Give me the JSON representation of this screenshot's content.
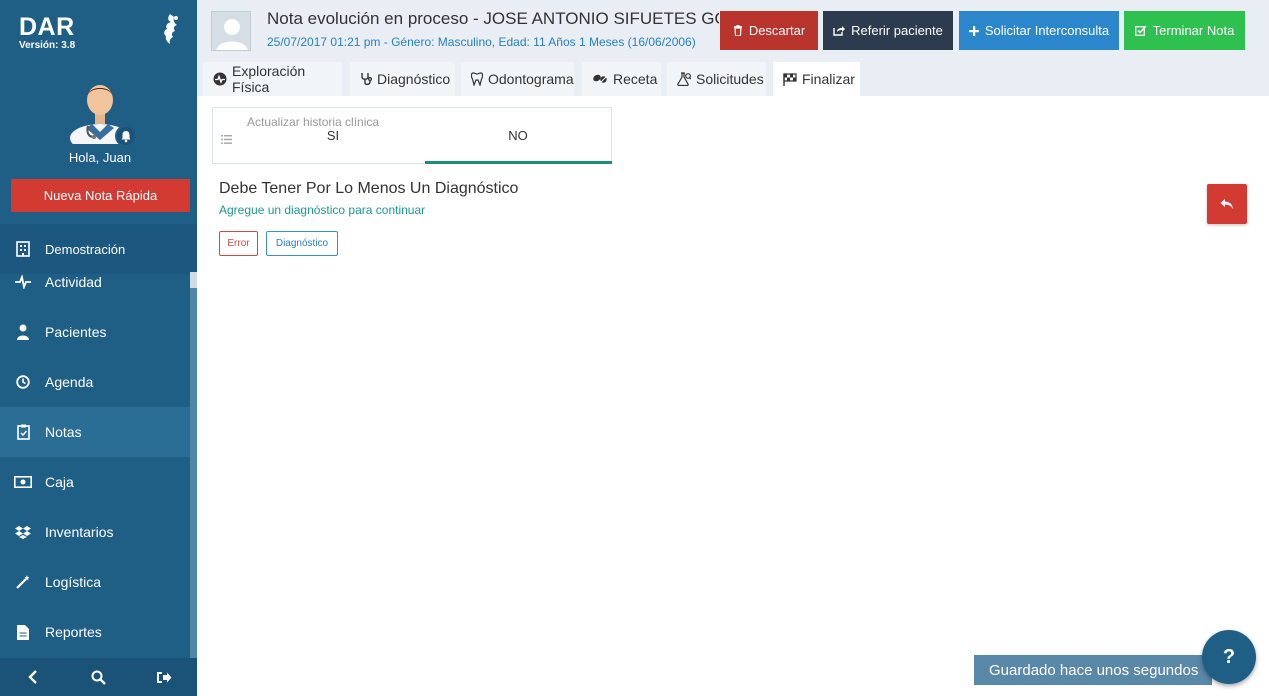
{
  "app": {
    "name": "DAR",
    "version": "Versión: 3.8"
  },
  "sidebar": {
    "greeting": "Hola, Juan",
    "quick_note_label": "Nueva Nota Rápida",
    "items": [
      {
        "label": "Demostración",
        "icon": "building-icon"
      },
      {
        "label": "Actividad",
        "icon": "pulse-icon"
      },
      {
        "label": "Pacientes",
        "icon": "user-icon"
      },
      {
        "label": "Agenda",
        "icon": "clock-icon"
      },
      {
        "label": "Notas",
        "icon": "clipboard-icon",
        "active": true
      },
      {
        "label": "Caja",
        "icon": "cash-icon"
      },
      {
        "label": "Inventarios",
        "icon": "dropbox-icon"
      },
      {
        "label": "Logística",
        "icon": "magic-wand-icon"
      },
      {
        "label": "Reportes",
        "icon": "file-icon"
      }
    ]
  },
  "header": {
    "title": "Nota evolución en proceso - JOSE ANTONIO SIFUETES GONZA",
    "subtitle": "25/07/2017 01:21 pm - Género: Masculino, Edad: 11 Años 1 Meses (16/06/2006)",
    "buttons": {
      "discard": "Descartar",
      "refer": "Referir paciente",
      "consult": "Solicitar Interconsulta",
      "finish": "Terminar Nota"
    }
  },
  "tabs": [
    {
      "label": "Exploración Física"
    },
    {
      "label": "Diagnóstico"
    },
    {
      "label": "Odontograma"
    },
    {
      "label": "Receta"
    },
    {
      "label": "Solicitudes"
    },
    {
      "label": "Finalizar",
      "active": true
    }
  ],
  "finalize": {
    "toggle_label": "Actualizar historia clínica",
    "option_yes": "SI",
    "option_no": "NO",
    "selected": "NO",
    "message_title": "Debe Tener Por Lo Menos Un Diagnóstico",
    "message_sub": "Agregue un diagnóstico para continuar",
    "tag_error": "Error",
    "tag_diagnosis": "Diagnóstico"
  },
  "status": {
    "saved": "Guardado hace unos segundos",
    "help": "?"
  },
  "colors": {
    "sidebar": "#1f5f86",
    "danger": "#d23a32",
    "primary": "#2c86cc",
    "success": "#2ec14f",
    "teal": "#1e8a80"
  }
}
